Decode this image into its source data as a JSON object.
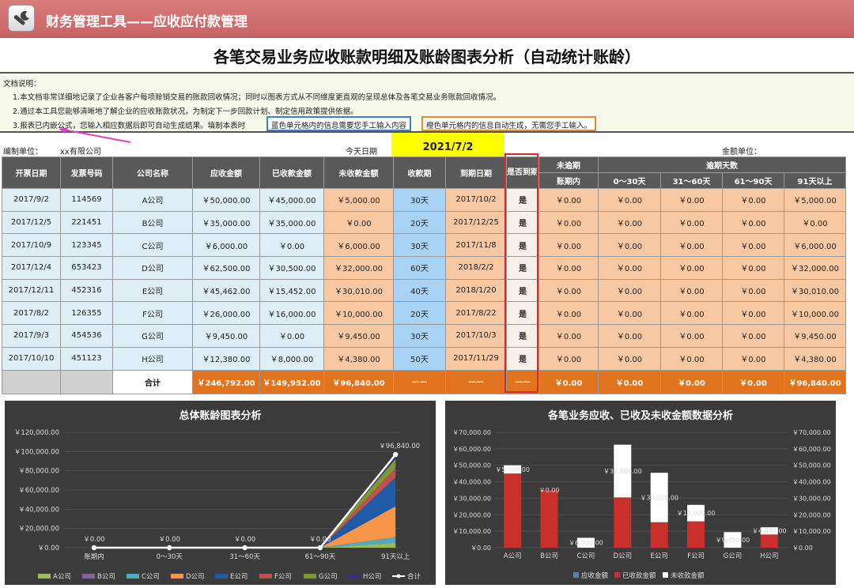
{
  "banner": {
    "title": "财务管理工具——应收应付款管理"
  },
  "main_title": "各笔交易业务应收账款明细及账龄图表分析（自动统计账龄）",
  "notes": {
    "heading": "文档说明：",
    "line1": "1.本文档非常详细地记录了企业各客户每项赊销交易的账款回收情况；同时以图表方式从不同维度更直观的呈现总体及各笔交易业务账款回收情况。",
    "line2": "2.通过本工具您能够清晰地了解企业的应收账款状况，为制定下一步回款计划、制定信用政策提供依据。",
    "line3": "3.报表已内嵌公式，您输入相应数据后即可自动生成结果。填制本表时",
    "blue_box": "蓝色单元格内的信息需要您手工输入内容",
    "orange_box": "橙色单元格内的信息自动生成，无需您手工输入。"
  },
  "meta": {
    "company_label": "编制单位：",
    "company": "xx有限公司",
    "today_label": "今天日期",
    "today": "2021/7/2",
    "unit_label": "金额单位："
  },
  "table": {
    "headers": [
      "开票日期",
      "发票号码",
      "公司名称",
      "应收金额",
      "已收款金额",
      "未收款金额",
      "收款期",
      "到期日期",
      "是否到期",
      "未逾期",
      "逾期天数"
    ],
    "sub_headers": [
      "账期内",
      "0～30天",
      "31～60天",
      "61～90天",
      "91天以上"
    ],
    "rows": [
      [
        "2017/9/2",
        "114569",
        "A公司",
        "￥50,000.00",
        "￥45,000.00",
        "￥5,000.00",
        "30天",
        "2017/10/2",
        "是",
        "￥0.00",
        "￥0.00",
        "￥0.00",
        "￥0.00",
        "￥5,000.00"
      ],
      [
        "2017/12/5",
        "221451",
        "B公司",
        "￥35,000.00",
        "￥35,000.00",
        "￥0.00",
        "20天",
        "2017/12/25",
        "是",
        "￥0.00",
        "￥0.00",
        "￥0.00",
        "￥0.00",
        "￥0.00"
      ],
      [
        "2017/10/9",
        "123345",
        "C公司",
        "￥6,000.00",
        "￥0.00",
        "￥6,000.00",
        "30天",
        "2017/11/8",
        "是",
        "￥0.00",
        "￥0.00",
        "￥0.00",
        "￥0.00",
        "￥6,000.00"
      ],
      [
        "2017/12/4",
        "653423",
        "D公司",
        "￥62,500.00",
        "￥30,500.00",
        "￥32,000.00",
        "60天",
        "2018/2/2",
        "是",
        "￥0.00",
        "￥0.00",
        "￥0.00",
        "￥0.00",
        "￥32,000.00"
      ],
      [
        "2017/12/11",
        "452316",
        "E公司",
        "￥45,462.00",
        "￥15,452.00",
        "￥30,010.00",
        "40天",
        "2018/1/20",
        "是",
        "￥0.00",
        "￥0.00",
        "￥0.00",
        "￥0.00",
        "￥30,010.00"
      ],
      [
        "2017/8/2",
        "126355",
        "F公司",
        "￥26,000.00",
        "￥16,000.00",
        "￥10,000.00",
        "20天",
        "2017/8/22",
        "是",
        "￥0.00",
        "￥0.00",
        "￥0.00",
        "￥0.00",
        "￥10,000.00"
      ],
      [
        "2017/9/3",
        "454536",
        "G公司",
        "￥9,450.00",
        "￥0.00",
        "￥9,450.00",
        "30天",
        "2017/10/3",
        "是",
        "￥0.00",
        "￥0.00",
        "￥0.00",
        "￥0.00",
        "￥9,450.00"
      ],
      [
        "2017/10/10",
        "451123",
        "H公司",
        "￥12,380.00",
        "￥8,000.00",
        "￥4,380.00",
        "50天",
        "2017/11/29",
        "是",
        "￥0.00",
        "￥0.00",
        "￥0.00",
        "￥0.00",
        "￥4,380.00"
      ]
    ],
    "total": [
      "",
      "",
      "合计",
      "￥246,792.00",
      "￥149,952.00",
      "￥96,840.00",
      "——",
      "——",
      "——",
      "￥0.00",
      "￥0.00",
      "￥0.00",
      "￥0.00",
      "￥96,840.00"
    ]
  },
  "colors": {
    "banner": "#c96464",
    "header": "#595959",
    "input_blue": "#a9d3f5",
    "auto_orange": "#f8c8a2",
    "total_orange": "#e2731f",
    "chart_bg": "#3b3b3b"
  },
  "chart_data": [
    {
      "type": "area",
      "title": "总体账龄图表分析",
      "categories": [
        "账期内",
        "0～30天",
        "31～60天",
        "61～90天",
        "91天以上"
      ],
      "ylim": [
        0,
        120000
      ],
      "yticks": [
        "￥0.00",
        "￥20,000.00",
        "￥40,000.00",
        "￥60,000.00",
        "￥80,000.00",
        "￥100,000.00",
        "￥120,000.00"
      ],
      "series": [
        {
          "name": "A公司",
          "color": "#9bbb59",
          "values": [
            0,
            0,
            0,
            0,
            5000
          ]
        },
        {
          "name": "B公司",
          "color": "#8064a2",
          "values": [
            0,
            0,
            0,
            0,
            0
          ]
        },
        {
          "name": "C公司",
          "color": "#4bacc6",
          "values": [
            0,
            0,
            0,
            0,
            6000
          ]
        },
        {
          "name": "D公司",
          "color": "#f79646",
          "values": [
            0,
            0,
            0,
            0,
            32000
          ]
        },
        {
          "name": "E公司",
          "color": "#1f5aa6",
          "values": [
            0,
            0,
            0,
            0,
            30010
          ]
        },
        {
          "name": "F公司",
          "color": "#c0504d",
          "values": [
            0,
            0,
            0,
            0,
            10000
          ]
        },
        {
          "name": "G公司",
          "color": "#7a9a30",
          "values": [
            0,
            0,
            0,
            0,
            9450
          ]
        },
        {
          "name": "H公司",
          "color": "#3b2d7a",
          "values": [
            0,
            0,
            0,
            0,
            4380
          ]
        },
        {
          "name": "合计",
          "color": "#ffffff",
          "values": [
            0,
            0,
            0,
            0,
            96840
          ],
          "line": true
        }
      ],
      "data_labels": [
        "￥0.00",
        "￥0.00",
        "￥0.00",
        "￥0.00",
        "￥96,840.00"
      ]
    },
    {
      "type": "bar",
      "title": "各笔业务应收、已收及未收金额数据分析",
      "categories": [
        "A公司",
        "B公司",
        "C公司",
        "D公司",
        "E公司",
        "F公司",
        "G公司",
        "H公司"
      ],
      "ylim": [
        0,
        70000
      ],
      "yticks": [
        "￥0.00",
        "￥10,000.00",
        "￥20,000.00",
        "￥30,000.00",
        "￥40,000.00",
        "￥50,000.00",
        "￥60,000.00",
        "￥70,000.00"
      ],
      "series": [
        {
          "name": "应收金额",
          "color": "#5b7fa6",
          "values": [
            50000,
            35000,
            6000,
            62500,
            45462,
            26000,
            9450,
            12380
          ]
        },
        {
          "name": "已收款金额",
          "color": "#c9302c",
          "values": [
            45000,
            35000,
            0,
            30500,
            15452,
            16000,
            0,
            8000
          ]
        },
        {
          "name": "未收款金额",
          "color": "#ffffff",
          "values": [
            5000,
            0,
            6000,
            32000,
            30010,
            10000,
            9450,
            4380
          ]
        }
      ],
      "data_labels": [
        "￥5,000.00",
        "￥0.00",
        "￥6,000.00",
        "￥32,000.00",
        "￥30,010.00",
        "￥10,000.00",
        "￥9,450.00",
        "￥4,380.00"
      ]
    }
  ]
}
